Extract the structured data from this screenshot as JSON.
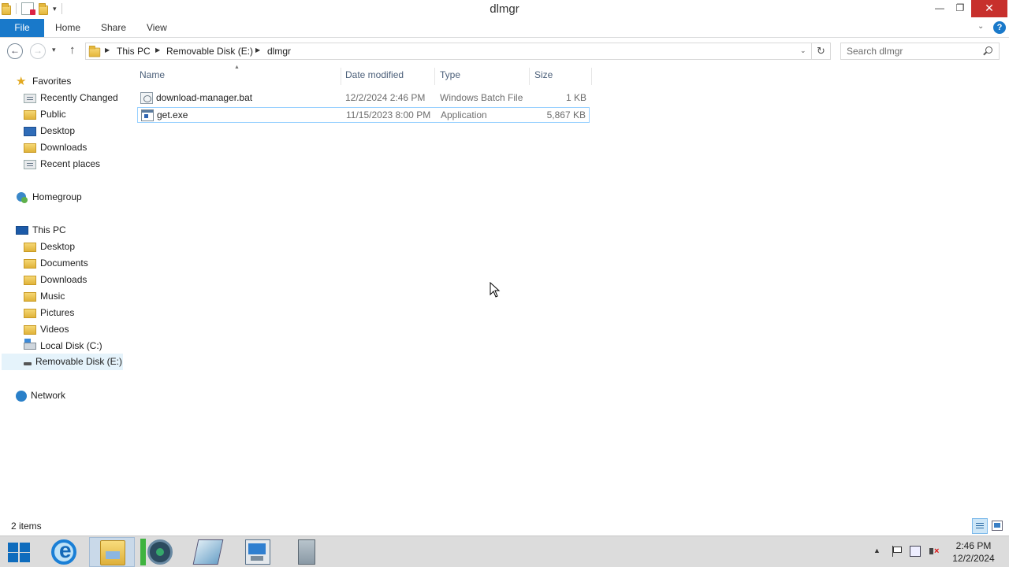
{
  "window": {
    "title": "dlmgr",
    "controls": {
      "minimize": "—",
      "maximize": "❐",
      "close": "✕"
    }
  },
  "ribbon": {
    "tabs": [
      "File",
      "Home",
      "Share",
      "View"
    ],
    "help": "?"
  },
  "address": {
    "crumbs": [
      "This PC",
      "Removable Disk (E:)",
      "dlmgr"
    ]
  },
  "search": {
    "placeholder": "Search dlmgr"
  },
  "nav": {
    "favorites": {
      "label": "Favorites",
      "items": [
        "Recently Changed",
        "Public",
        "Desktop",
        "Downloads",
        "Recent places"
      ]
    },
    "homegroup": "Homegroup",
    "this_pc": {
      "label": "This PC",
      "items": [
        "Desktop",
        "Documents",
        "Downloads",
        "Music",
        "Pictures",
        "Videos",
        "Local Disk (C:)",
        "Removable Disk (E:)"
      ],
      "selected": "Removable Disk (E:)"
    },
    "network": "Network"
  },
  "files": {
    "columns": {
      "name": "Name",
      "date": "Date modified",
      "type": "Type",
      "size": "Size"
    },
    "rows": [
      {
        "name": "download-manager.bat",
        "date": "12/2/2024 2:46 PM",
        "type": "Windows Batch File",
        "size": "1 KB",
        "icon": "batch-file-icon"
      },
      {
        "name": "get.exe",
        "date": "11/15/2023 8:00 PM",
        "type": "Application",
        "size": "5,867 KB",
        "icon": "application-icon"
      }
    ]
  },
  "status": {
    "item_count": "2 items"
  },
  "taskbar": {
    "clock_time": "2:46 PM",
    "clock_date": "12/2/2024"
  }
}
